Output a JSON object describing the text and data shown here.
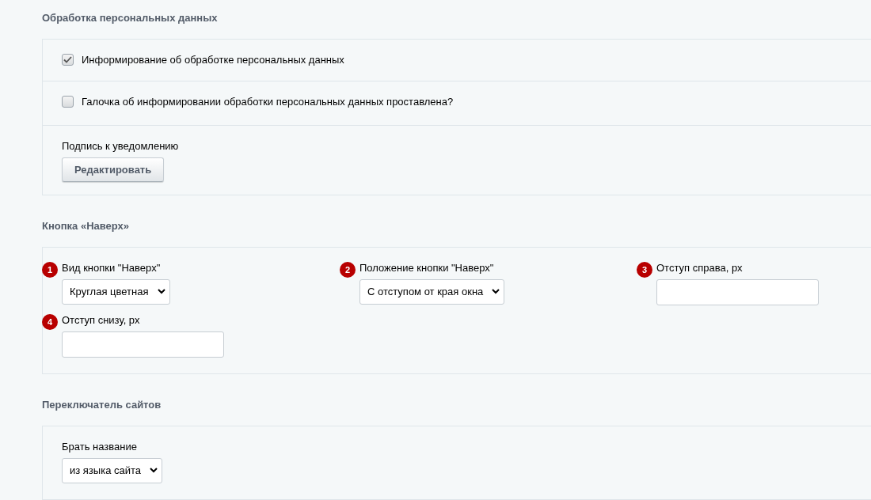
{
  "sections": [
    {
      "title": "Обработка персональных данных",
      "kind": "rows",
      "rows": [
        {
          "kind": "checkbox",
          "label": "Информирование об обработке персональных данных",
          "checked": true
        },
        {
          "kind": "checkbox",
          "label": "Галочка об информировании обработки персональных данных проставлена?",
          "checked": false
        },
        {
          "kind": "button",
          "label": "Подпись к уведомлению",
          "button": "Редактировать"
        }
      ]
    },
    {
      "title": "Кнопка «Наверх»",
      "kind": "grid",
      "fields": [
        {
          "badge": "1",
          "label": "Вид кнопки \"Наверх\"",
          "kind": "select",
          "value": "Круглая цветная"
        },
        {
          "badge": "2",
          "label": "Положение кнопки \"Наверх\"",
          "kind": "select",
          "value": "С отступом от края окна"
        },
        {
          "badge": "3",
          "label": "Отступ справа, px",
          "kind": "input"
        },
        {
          "badge": "4",
          "label": "Отступ снизу, px",
          "kind": "input"
        }
      ]
    },
    {
      "title": "Переключатель сайтов",
      "kind": "grid",
      "fields": [
        {
          "label": "Брать название",
          "kind": "select",
          "value": "из языка сайта"
        }
      ]
    }
  ]
}
